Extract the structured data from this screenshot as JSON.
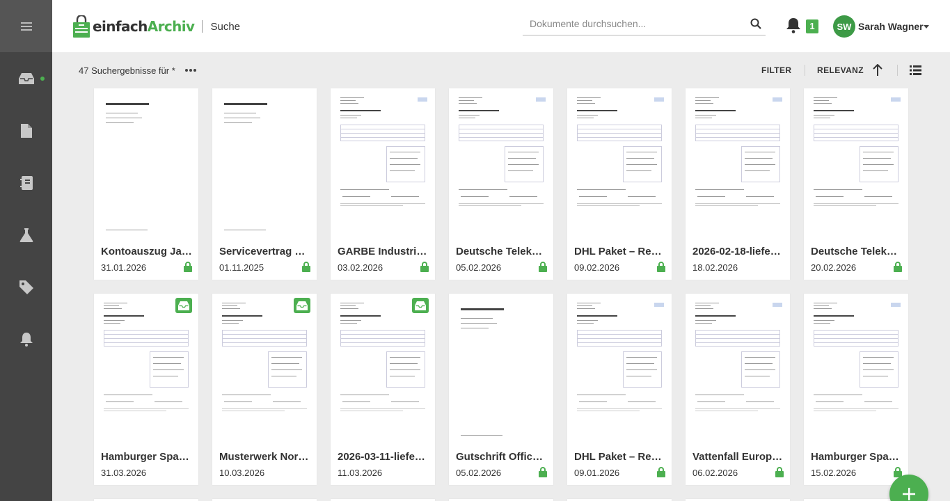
{
  "app": {
    "logo_part1": "einfach",
    "logo_part2": "Archiv",
    "page_title": "Suche"
  },
  "header": {
    "search_placeholder": "Dokumente durchsuchen...",
    "notification_count": "1",
    "user_initials": "SW",
    "user_name": "Sarah Wagner"
  },
  "sidebar": {
    "items": [
      {
        "icon": "inbox-icon",
        "active": true
      },
      {
        "icon": "document-icon"
      },
      {
        "icon": "binder-icon"
      },
      {
        "icon": "flask-icon"
      },
      {
        "icon": "tag-icon"
      },
      {
        "icon": "bell-icon"
      }
    ]
  },
  "toolbar": {
    "results_text": "47 Suchergebnisse für *",
    "filter_label": "FILTER",
    "sort_label": "RELEVANZ"
  },
  "colors": {
    "accent": "#4caf50",
    "sidebar": "#444444",
    "background": "#ececec"
  },
  "cards": [
    {
      "title": "Kontoauszug Ja…",
      "date": "31.01.2026",
      "lock": true,
      "inbox": false,
      "style": "plain"
    },
    {
      "title": "Servicevertrag C…",
      "date": "01.11.2025",
      "lock": true,
      "inbox": false,
      "style": "plain"
    },
    {
      "title": "GARBE Industria…",
      "date": "03.02.2026",
      "lock": true,
      "inbox": false,
      "style": "invoice"
    },
    {
      "title": "Deutsche Teleko…",
      "date": "05.02.2026",
      "lock": true,
      "inbox": false,
      "style": "invoice"
    },
    {
      "title": "DHL Paket – Rec…",
      "date": "09.02.2026",
      "lock": true,
      "inbox": false,
      "style": "invoice"
    },
    {
      "title": "2026-02-18-liefe…",
      "date": "18.02.2026",
      "lock": false,
      "inbox": false,
      "style": "invoice"
    },
    {
      "title": "Deutsche Teleko…",
      "date": "20.02.2026",
      "lock": true,
      "inbox": false,
      "style": "invoice"
    },
    {
      "title": "Hamburger Spar…",
      "date": "31.03.2026",
      "lock": false,
      "inbox": true,
      "style": "invoice"
    },
    {
      "title": "Musterwerk Nor…",
      "date": "10.03.2026",
      "lock": false,
      "inbox": true,
      "style": "invoice"
    },
    {
      "title": "2026-03-11-liefe…",
      "date": "11.03.2026",
      "lock": false,
      "inbox": true,
      "style": "invoice"
    },
    {
      "title": "Gutschrift Office…",
      "date": "05.02.2026",
      "lock": true,
      "inbox": false,
      "style": "plain"
    },
    {
      "title": "DHL Paket – Rec…",
      "date": "09.01.2026",
      "lock": true,
      "inbox": false,
      "style": "invoice"
    },
    {
      "title": "Vattenfall Europ…",
      "date": "06.02.2026",
      "lock": true,
      "inbox": false,
      "style": "invoice"
    },
    {
      "title": "Hamburger Spar…",
      "date": "15.02.2026",
      "lock": true,
      "inbox": false,
      "style": "invoice"
    }
  ]
}
